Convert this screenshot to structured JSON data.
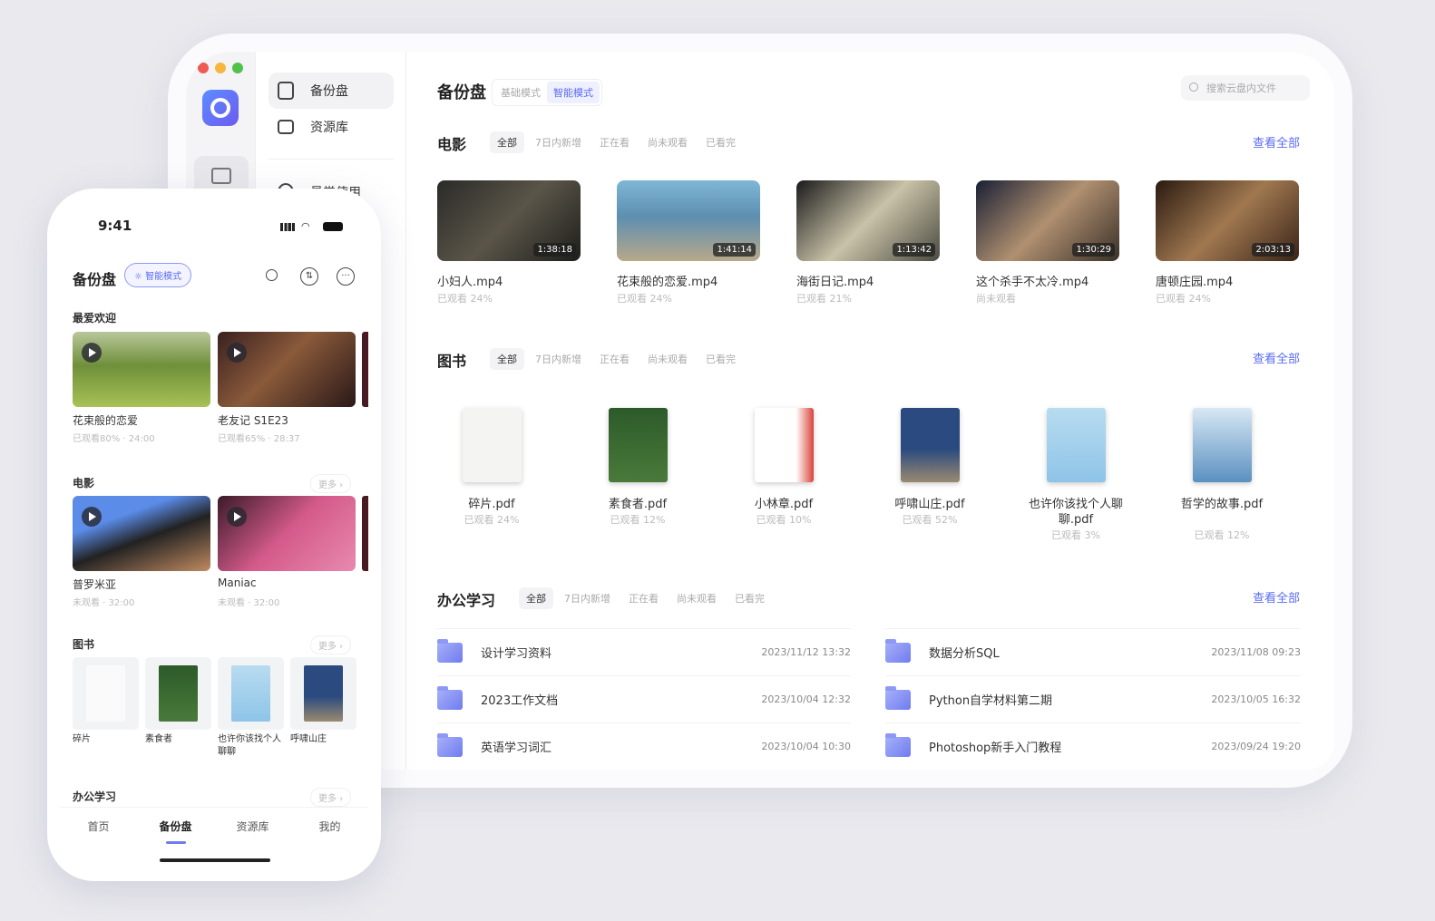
{
  "desktop": {
    "nav": [
      {
        "label": "备份盘",
        "icon": "drive-icon",
        "active": true
      },
      {
        "label": "资源库",
        "icon": "folder-share-icon"
      },
      {
        "label": "最常使用",
        "icon": "clock-icon"
      }
    ],
    "title": "备份盘",
    "modes": [
      "基础模式",
      "智能模式"
    ],
    "search_placeholder": "搜索云盘内文件",
    "filters": [
      "全部",
      "7日内新增",
      "正在看",
      "尚未观看",
      "已看完"
    ],
    "view_all": "查看全部",
    "movies": {
      "title": "电影",
      "items": [
        {
          "name": "小妇人.mp4",
          "duration": "1:38:18",
          "status": "已观看 24%"
        },
        {
          "name": "花束般的恋爱.mp4",
          "duration": "1:41:14",
          "status": "已观看 24%"
        },
        {
          "name": "海街日记.mp4",
          "duration": "1:13:42",
          "status": "已观看 21%"
        },
        {
          "name": "这个杀手不太冷.mp4",
          "duration": "1:30:29",
          "status": "尚未观看"
        },
        {
          "name": "唐顿庄园.mp4",
          "duration": "2:03:13",
          "status": "已观看 24%"
        }
      ]
    },
    "books": {
      "title": "图书",
      "items": [
        {
          "name": "碎片.pdf",
          "status": "已观看 24%"
        },
        {
          "name": "素食者.pdf",
          "status": "已观看 12%"
        },
        {
          "name": "小林章.pdf",
          "status": "已观看 10%"
        },
        {
          "name": "呼啸山庄.pdf",
          "status": "已观看 52%"
        },
        {
          "name": "也许你该找个人聊聊.pdf",
          "status": "已观看 3%"
        },
        {
          "name": "哲学的故事.pdf",
          "status": "已观看 12%"
        }
      ]
    },
    "office": {
      "title": "办公学习",
      "items": [
        {
          "name": "设计学习资料",
          "date": "2023/11/12 13:32"
        },
        {
          "name": "数据分析SQL",
          "date": "2023/11/08 09:23"
        },
        {
          "name": "2023工作文档",
          "date": "2023/10/04 12:32"
        },
        {
          "name": "Python自学材料第二期",
          "date": "2023/10/05 16:32"
        },
        {
          "name": "英语学习词汇",
          "date": "2023/10/04 10:30"
        },
        {
          "name": "Photoshop新手入门教程",
          "date": "2023/09/24 19:20"
        }
      ]
    }
  },
  "phone": {
    "time": "9:41",
    "title": "备份盘",
    "mode": "智能模式",
    "more": "更多 ›",
    "popular": {
      "title": "最爱欢迎",
      "items": [
        {
          "name": "花束般的恋爱",
          "meta": "已观看80% · 24:00"
        },
        {
          "name": "老友记 S1E23",
          "meta": "已观看65% · 28:37"
        }
      ]
    },
    "movies": {
      "title": "电影",
      "items": [
        {
          "name": "普罗米亚",
          "meta": "未观看 · 32:00"
        },
        {
          "name": "Maniac",
          "meta": "未观看 · 32:00"
        }
      ]
    },
    "books": {
      "title": "图书",
      "items": [
        "碎片",
        "素食者",
        "也许你该找个人聊聊",
        "呼啸山庄"
      ]
    },
    "office": {
      "title": "办公学习"
    },
    "tabs": [
      "首页",
      "备份盘",
      "资源库",
      "我的"
    ]
  },
  "colors": {
    "accent": "#5b6cf2"
  }
}
